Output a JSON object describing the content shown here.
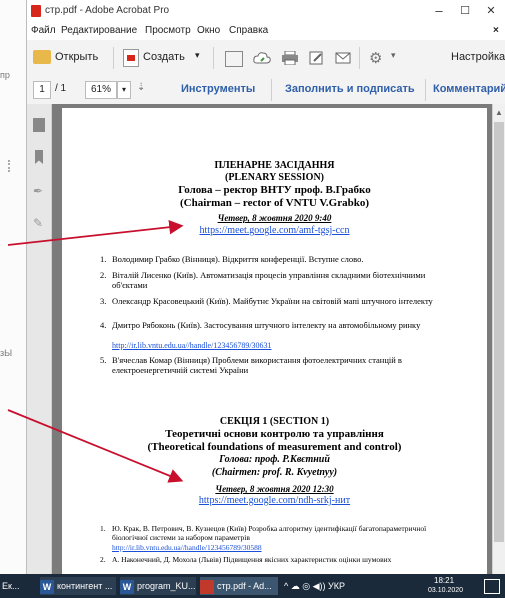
{
  "background_app": {
    "fragments": [
      "пр",
      "зЫ"
    ]
  },
  "window": {
    "title": "стр.pdf - Adobe Acrobat Pro",
    "controls": {
      "minimize": "–",
      "maximize": "☐",
      "close": "✕"
    }
  },
  "menu": {
    "items": [
      "Файл",
      "Редактирование",
      "Просмотр",
      "Окно",
      "Справка"
    ],
    "close_doc": "×"
  },
  "toolbar": {
    "open_label": "Открыть",
    "create_label": "Создать",
    "create_arrow": "▾",
    "more_arrow": "▾",
    "settings_label": "Настройка"
  },
  "nav": {
    "page_current": "1",
    "page_total": "/ 1",
    "zoom": "61%",
    "zoom_arrow": "▾",
    "tools_label": "Инструменты",
    "sign_label": "Заполнить и подписать",
    "comment_label": "Комментарий"
  },
  "document": {
    "plenary": {
      "h1": "ПЛЕНАРНЕ ЗАСІДАННЯ",
      "h2": "(PLENARY SESSION)",
      "h3": "Голова – ректор ВНТУ проф. В.Грабко",
      "h4": "(Chairman – rector of VNTU V.Grabko)",
      "date": "Четвер, 8 жовтня 2020 9:40",
      "link": "https://meet.google.com/amf-tgsj-ccn"
    },
    "plenary_items": [
      {
        "n": "1.",
        "text": "Володимир Грабко (Вінниця). Відкриття конференції. Вступне слово."
      },
      {
        "n": "2.",
        "text": "Віталій Лисенко (Київ). Автоматизація процесів управління складними біотехнічними об'єктами"
      },
      {
        "n": "3.",
        "text": "Олександр Красовецький (Київ). Майбутнє України на світовій мапі штучного інтелекту"
      },
      {
        "n": "4.",
        "text": "Дмитро Рябоконь (Київ). Застосування штучного інтелекту на автомобільному ринку",
        "link": "http://ir.lib.vntu.edu.ua//handle/123456789/30631"
      },
      {
        "n": "5.",
        "text": "В'ячеслав Комар (Вінниця) Проблеми використання фотоелектричних станцій в електроенергетичній системі України"
      }
    ],
    "section": {
      "h1": "СЕКЦІЯ 1 (SECTION 1)",
      "h2": "Теоретичні основи контролю та управління",
      "h3": "(Theoretical foundations of measurement and control)",
      "h4": "Голова: проф. Р.Квєтний",
      "h5": "(Chairmen: prof. R. Kvyetnyy)",
      "date": "Четвер, 8 жовтня 2020 12:30",
      "link": "https://meet.google.com/ndh-srkj-нит"
    },
    "section_items": [
      {
        "n": "1.",
        "text": "Ю. Крак, В. Петрович, В. Кузнецов (Київ) Розробка алгоритму ідентифікації багатопараметричної біологічної системи за набором параметрів",
        "link": "http://ir.lib.vntu.edu.ua//handle/123456789/30588"
      },
      {
        "n": "2.",
        "text": "А. Наконечний, Д. Мохола (Львів) Підвищення якісних характеристик оцінки шумових"
      }
    ]
  },
  "taskbar": {
    "items": [
      "Ек...",
      "контингент ...",
      "program_KU...",
      "стр.pdf - Ad..."
    ],
    "tray": "^ ☁ ◎ ◀)) УКР",
    "time": "18:21",
    "date": "03.10.2020"
  },
  "colors": {
    "accent": "#1a4fd8",
    "arrow": "#c8102e",
    "acrobat_red": "#d8261b"
  }
}
